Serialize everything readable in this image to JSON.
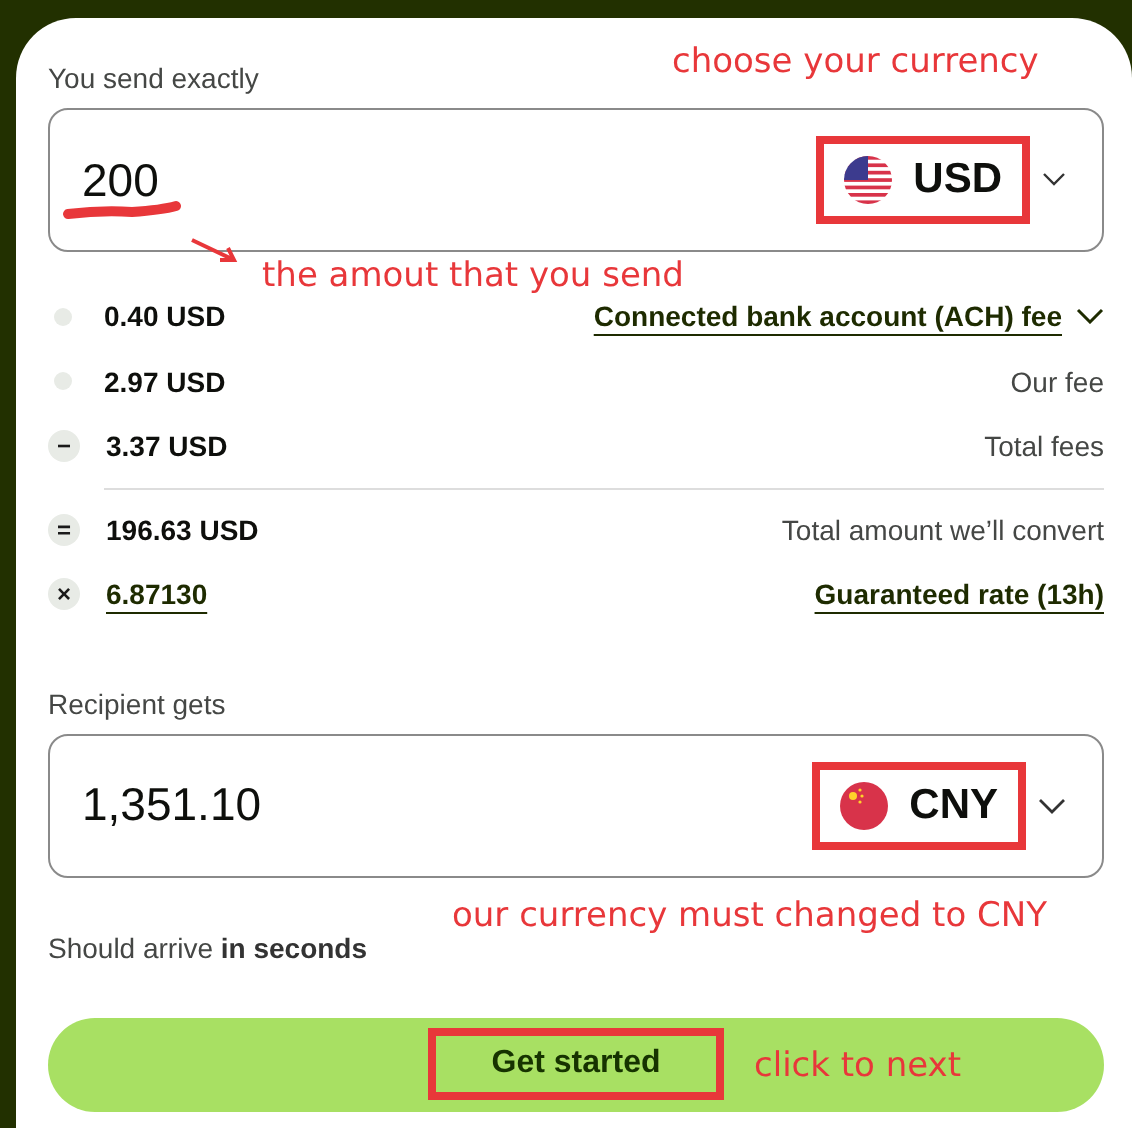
{
  "send": {
    "label": "You send exactly",
    "value": "200",
    "currency": "USD",
    "highlighted": true,
    "underlined": true
  },
  "breakdown": [
    {
      "amount": "0.40 USD",
      "label": "Connected bank account (ACH) fee",
      "amount_link": false,
      "label_link": true,
      "expandable": true
    },
    {
      "amount": "2.97 USD",
      "label": "Our fee",
      "amount_link": false,
      "label_link": false
    },
    {
      "symbol": "−",
      "amount": "3.37 USD",
      "label": "Total fees",
      "amount_link": false,
      "label_link": false,
      "divider_after": true
    },
    {
      "symbol": "=",
      "amount": "196.63 USD",
      "label": "Total amount we’ll convert",
      "amount_link": false,
      "label_link": false
    },
    {
      "symbol": "×",
      "amount": "6.87130",
      "label": "Guaranteed rate (13h)",
      "amount_link": true,
      "label_link": true
    }
  ],
  "receive": {
    "label": "Recipient gets",
    "value": "1,351.10",
    "currency": "CNY",
    "highlighted": true
  },
  "arrival": "Should arrive **in seconds**",
  "button": {
    "label": "Get started",
    "highlighted": true
  },
  "annotations": [
    {
      "kind": "note",
      "text": "choose your currency"
    },
    {
      "kind": "note-arrow",
      "text": "the amout that you send"
    },
    {
      "kind": "note",
      "text": "our currency must changed to CNY"
    },
    {
      "kind": "note",
      "text": "click to next"
    }
  ]
}
